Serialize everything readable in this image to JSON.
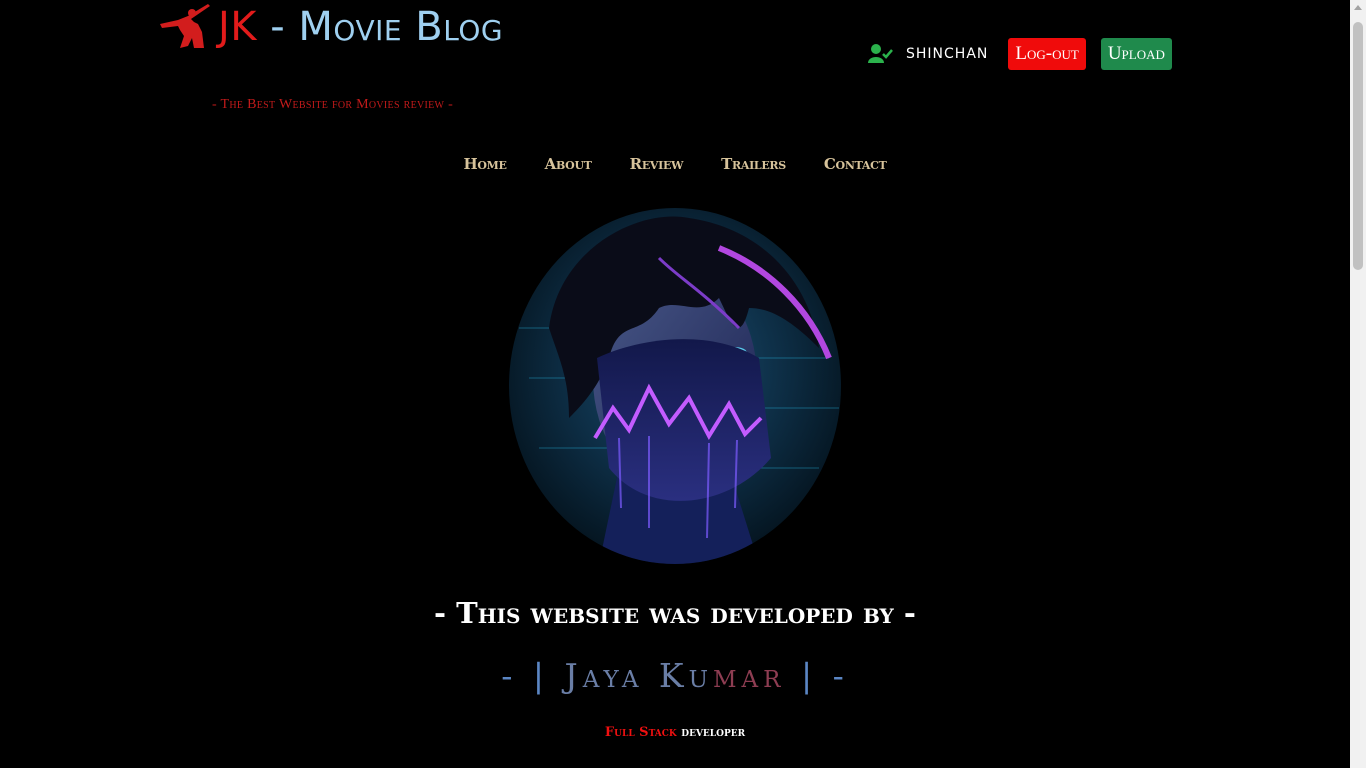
{
  "header": {
    "logo_jk": "JK",
    "logo_separator": " - ",
    "logo_title": "Movie Blog",
    "tagline": "- The Best Website for Movies review -"
  },
  "user": {
    "username": "SHINCHAN",
    "logout_label": "Log-out",
    "upload_label": "Upload"
  },
  "nav": {
    "items": [
      "Home",
      "About",
      "Review",
      "Trailers",
      "Contact"
    ]
  },
  "developer": {
    "heading": "- This website was developed by -",
    "name_prefix": "- |",
    "name_part1": "Jaya Ku",
    "name_part2": "mar",
    "name_suffix": "| -",
    "role_part1": "Full Stack",
    "role_part2": "developer"
  },
  "colors": {
    "background": "#000000",
    "brand_red": "#e21b1b",
    "brand_blue": "#9fd0f0",
    "nav_text": "#d7c39b",
    "logout_button": "#f00b0b",
    "upload_button": "#1f8a4c"
  },
  "icons": {
    "logo": "samurai-icon",
    "user": "user-check-icon"
  }
}
